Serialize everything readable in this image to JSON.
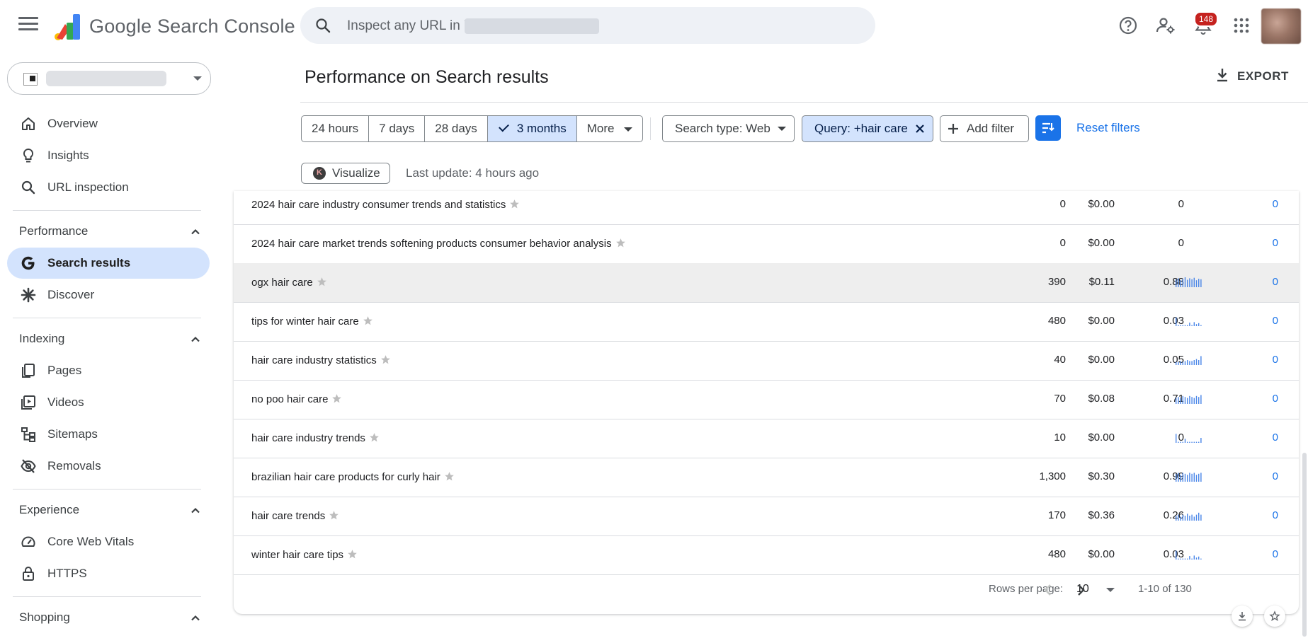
{
  "app": {
    "brand": "Google Search Console",
    "notifications_count": "148"
  },
  "search": {
    "placeholder": "Inspect any URL in \""
  },
  "sidebar": {
    "items": {
      "overview": "Overview",
      "insights": "Insights",
      "url_inspection": "URL inspection",
      "search_results": "Search results",
      "discover": "Discover",
      "pages": "Pages",
      "videos": "Videos",
      "sitemaps": "Sitemaps",
      "removals": "Removals",
      "core_web_vitals": "Core Web Vitals",
      "https": "HTTPS"
    },
    "sections": {
      "performance": "Performance",
      "indexing": "Indexing",
      "experience": "Experience",
      "shopping": "Shopping"
    }
  },
  "header": {
    "title": "Performance on Search results",
    "export_label": "EXPORT"
  },
  "filters": {
    "date_ranges": [
      "24 hours",
      "7 days",
      "28 days",
      "3 months",
      "More"
    ],
    "selected_range": "3 months",
    "search_type": "Search type: Web",
    "query": "Query: +hair care",
    "add_filter": "Add filter",
    "reset": "Reset filters"
  },
  "visualize": {
    "label": "Visualize",
    "last_update": "Last update: 4 hours ago"
  },
  "table": {
    "rows": [
      {
        "query": "2024 hair care industry consumer trends and statistics",
        "c1": "0",
        "c2": "$0.00",
        "c3": "0",
        "c5": "0",
        "trend": []
      },
      {
        "query": "2024 hair care market trends softening products consumer behavior analysis",
        "c1": "0",
        "c2": "$0.00",
        "c3": "0",
        "c5": "0",
        "trend": []
      },
      {
        "query": "ogx hair care",
        "c1": "390",
        "c2": "$0.11",
        "c3": "0.88",
        "c5": "0",
        "trend": [
          0.8,
          0.9,
          0.7,
          0.85,
          1,
          0.75,
          0.9,
          0.8,
          0.95,
          0.7,
          0.85,
          0.8
        ],
        "highlight": true
      },
      {
        "query": "tips for winter hair care",
        "c1": "480",
        "c2": "$0.00",
        "c3": "0.03",
        "c5": "0",
        "trend": [
          0.9,
          0.1,
          0.1,
          0.1,
          0.1,
          0.1,
          0.35,
          0.1,
          0.4,
          0.2,
          0.3,
          0.1
        ]
      },
      {
        "query": "hair care industry statistics",
        "c1": "40",
        "c2": "$0.00",
        "c3": "0.05",
        "c5": "0",
        "trend": [
          0.3,
          0.3,
          0.4,
          0.3,
          0.4,
          0.5,
          0.4,
          0.4,
          0.5,
          0.6,
          0.5,
          0.9
        ]
      },
      {
        "query": "no poo hair care",
        "c1": "70",
        "c2": "$0.08",
        "c3": "0.71",
        "c5": "0",
        "trend": [
          0.6,
          0.7,
          0.6,
          0.8,
          0.7,
          0.6,
          0.8,
          0.7,
          0.6,
          0.8,
          0.7,
          0.9
        ]
      },
      {
        "query": "hair care industry trends",
        "c1": "10",
        "c2": "$0.00",
        "c3": "0",
        "c5": "0",
        "trend": [
          0.9,
          0.1,
          0.1,
          0.1,
          0.4,
          0.1,
          0.1,
          0.1,
          0.1,
          0.1,
          0.1,
          0.5
        ]
      },
      {
        "query": "brazilian hair care products for curly hair",
        "c1": "1,300",
        "c2": "$0.30",
        "c3": "0.99",
        "c5": "0",
        "trend": [
          0.8,
          0.9,
          0.7,
          0.9,
          0.8,
          0.7,
          0.9,
          0.8,
          0.9,
          0.7,
          0.8,
          0.9
        ]
      },
      {
        "query": "hair care trends",
        "c1": "170",
        "c2": "$0.36",
        "c3": "0.26",
        "c5": "0",
        "trend": [
          0.5,
          0.6,
          0.4,
          0.6,
          0.5,
          0.7,
          0.5,
          0.6,
          0.4,
          0.6,
          0.8,
          0.6
        ]
      },
      {
        "query": "winter hair care tips",
        "c1": "480",
        "c2": "$0.00",
        "c3": "0.03",
        "c5": "0",
        "trend": [
          0.9,
          0.1,
          0.1,
          0.1,
          0.1,
          0.1,
          0.35,
          0.1,
          0.4,
          0.2,
          0.3,
          0.1
        ]
      }
    ],
    "rows_per_page_label": "Rows per page:",
    "rows_per_page": "10",
    "range": "1-10 of 130"
  },
  "colors": {
    "accent": "#1a73e8",
    "active_nav": "#d3e3fd",
    "spark": "#4a86e8"
  }
}
